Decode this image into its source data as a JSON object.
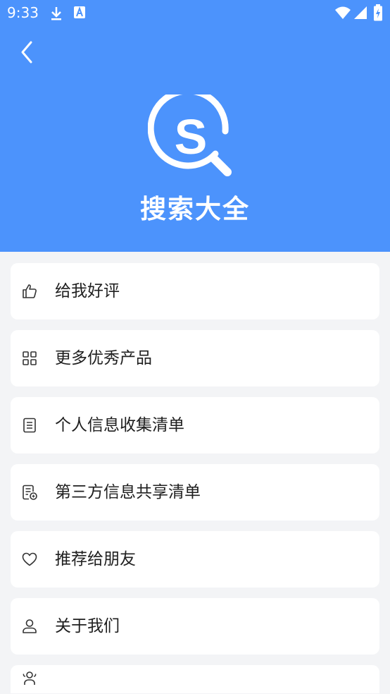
{
  "status_bar": {
    "time": "9:33",
    "icons": [
      "download-icon",
      "keyboard-a-icon",
      "wifi-icon",
      "signal-icon",
      "battery-charging-icon"
    ]
  },
  "header": {
    "background_color": "#4c93fc",
    "back_icon": "chevron-left-icon",
    "logo_letter": "S",
    "app_title": "搜索大全"
  },
  "menu": {
    "items": [
      {
        "label": "给我好评",
        "icon": "thumbs-up-icon"
      },
      {
        "label": "更多优秀产品",
        "icon": "grid-icon"
      },
      {
        "label": "个人信息收集清单",
        "icon": "list-document-icon"
      },
      {
        "label": "第三方信息共享清单",
        "icon": "shared-document-icon"
      },
      {
        "label": "推荐给朋友",
        "icon": "heart-icon"
      },
      {
        "label": "关于我们",
        "icon": "person-icon"
      },
      {
        "label": "",
        "icon": "group-icon"
      }
    ]
  }
}
